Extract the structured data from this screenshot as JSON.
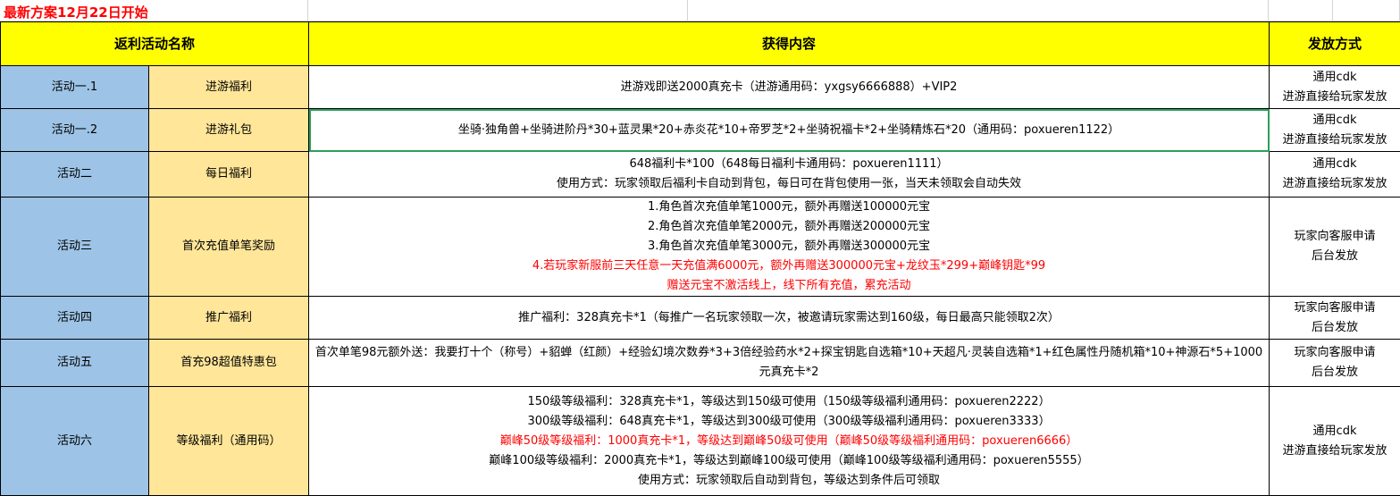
{
  "sheet": {
    "notice": "最新方案12月22日开始",
    "headers": [
      "返利活动名称",
      "获得内容",
      "发放方式"
    ],
    "rows": [
      {
        "id": "活动一.1",
        "name": "进游福利",
        "content": [
          {
            "text": "进游戏即送2000真充卡（进游通用码：yxgsy6666888）+VIP2",
            "red": false
          }
        ],
        "method": [
          "通用cdk",
          "进游直接给玩家发放"
        ]
      },
      {
        "id": "活动一.2",
        "name": "进游礼包",
        "content": [
          {
            "text": "坐骑·独角兽+坐骑进阶丹*30+蓝灵果*20+赤炎花*10+帝罗芝*2+坐骑祝福卡*2+坐骑精炼石*20（通用码：poxueren1122）",
            "red": false
          }
        ],
        "method": [
          "通用cdk",
          "进游直接给玩家发放"
        ]
      },
      {
        "id": "活动二",
        "name": "每日福利",
        "content": [
          {
            "text": "648福利卡*100（648每日福利卡通用码：poxueren1111）",
            "red": false
          },
          {
            "text": "使用方式：玩家领取后福利卡自动到背包，每日可在背包使用一张，当天未领取会自动失效",
            "red": false
          }
        ],
        "method": [
          "通用cdk",
          "进游直接给玩家发放"
        ]
      },
      {
        "id": "活动三",
        "name": "首次充值单笔奖励",
        "content": [
          {
            "text": "1.角色首次充值单笔1000元，额外再赠送100000元宝",
            "red": false
          },
          {
            "text": "2.角色首次充值单笔2000元，额外再赠送200000元宝",
            "red": false
          },
          {
            "text": "3.角色首次充值单笔3000元，额外再赠送300000元宝",
            "red": false
          },
          {
            "text": "4.若玩家新服前三天任意一天充值满6000元，额外再赠送300000元宝+龙纹玉*299+巅峰钥匙*99",
            "red": true
          },
          {
            "text": "赠送元宝不激活线上，线下所有充值，累充活动",
            "red": true
          }
        ],
        "method": [
          "玩家向客服申请",
          "后台发放"
        ]
      },
      {
        "id": "活动四",
        "name": "推广福利",
        "content": [
          {
            "text": "推广福利：328真充卡*1（每推广一名玩家领取一次，被邀请玩家需达到160级，每日最高只能领取2次）",
            "red": false
          }
        ],
        "method": [
          "玩家向客服申请",
          "后台发放"
        ]
      },
      {
        "id": "活动五",
        "name": "首充98超值特惠包",
        "content": [
          {
            "text": "首次单笔98元额外送：我要打十个（称号）+貂蝉（红颜）+经验幻境次数券*3+3倍经验药水*2+探宝钥匙自选箱*10+天超凡·灵装自选箱*1+红色属性丹随机箱*10+神源石*5+1000元真充卡*2",
            "red": false,
            "wrap": true
          }
        ],
        "method": [
          "玩家向客服申请",
          "后台发放"
        ]
      },
      {
        "id": "活动六",
        "name": "等级福利（通用码）",
        "content": [
          {
            "text": "150级等级福利：328真充卡*1，等级达到150级可使用（150级等级福利通用码：poxueren2222）",
            "red": false
          },
          {
            "text": "300级等级福利：648真充卡*1，等级达到300级可使用（300级等级福利通用码：poxueren3333）",
            "red": false
          },
          {
            "text": "巅峰50级等级福利：1000真充卡*1，等级达到巅峰50级可使用（巅峰50级等级福利通用码：poxueren6666）",
            "red": true
          },
          {
            "text": "巅峰100级等级福利：2000真充卡*1，等级达到巅峰100级可使用（巅峰100级等级福利通用码：poxueren5555）",
            "red": false
          },
          {
            "text": "使用方式：玩家领取后自动到背包，等级达到条件后可领取",
            "red": false
          }
        ],
        "method": [
          "通用cdk",
          "进游直接给玩家发放"
        ]
      }
    ]
  }
}
